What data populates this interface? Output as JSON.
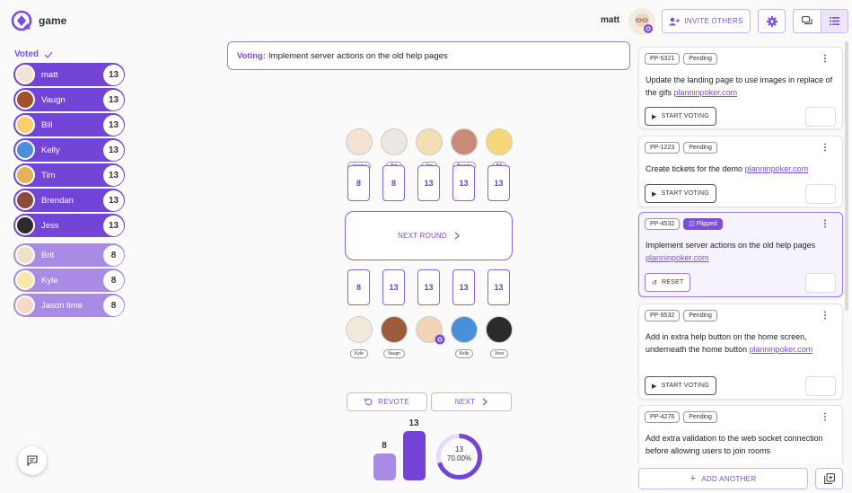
{
  "app": {
    "title": "game"
  },
  "header": {
    "username": "matt",
    "invite_label": "INVITE OTHERS"
  },
  "sidebar": {
    "voted_label": "Voted",
    "voters": [
      {
        "name": "matt",
        "vote": "13",
        "tone": "dark"
      },
      {
        "name": "Vaugn",
        "vote": "13",
        "tone": "dark"
      },
      {
        "name": "Bill",
        "vote": "13",
        "tone": "dark"
      },
      {
        "name": "Kelly",
        "vote": "13",
        "tone": "dark"
      },
      {
        "name": "Tim",
        "vote": "13",
        "tone": "dark"
      },
      {
        "name": "Brendan",
        "vote": "13",
        "tone": "dark"
      },
      {
        "name": "Jess",
        "vote": "13",
        "tone": "dark"
      },
      {
        "name": "Brit",
        "vote": "8",
        "tone": "light"
      },
      {
        "name": "Kyle",
        "vote": "8",
        "tone": "light"
      },
      {
        "name": "Jason time",
        "vote": "8",
        "tone": "light"
      }
    ]
  },
  "voting": {
    "label": "Voting:",
    "ticket": "Implement server actions on the old help pages"
  },
  "table": {
    "top_players": [
      {
        "name": "Jason t",
        "card": "8"
      },
      {
        "name": "Brit",
        "card": "8"
      },
      {
        "name": "Tim",
        "card": "13"
      },
      {
        "name": "Brenda",
        "card": "13"
      },
      {
        "name": "Bill",
        "card": "13"
      }
    ],
    "bottom_players": [
      {
        "name": "Kyle",
        "card": "8"
      },
      {
        "name": "Vaugn",
        "card": "13"
      },
      {
        "name": "",
        "card": "13"
      },
      {
        "name": "Kelly",
        "card": "13"
      },
      {
        "name": "Jess",
        "card": "13"
      }
    ],
    "next_round_label": "NEXT ROUND"
  },
  "controls": {
    "revote_label": "REVOTE",
    "next_label": "NEXT"
  },
  "results": {
    "bars": [
      {
        "label": "8",
        "count": 3
      },
      {
        "label": "13",
        "count": 7
      }
    ],
    "consensus_value": "13",
    "consensus_percent": "70.00%",
    "consensus_fraction": 0.7
  },
  "tickets": [
    {
      "id": "PP-5321",
      "status": "Pending",
      "text": "Update the landing page to use images in replace of the gifs",
      "link": "planninpoker.com",
      "action": "START VOTING"
    },
    {
      "id": "PP-1223",
      "status": "Pending",
      "text": "Create tickets for the demo",
      "link": "planninpoker.com",
      "action": "START VOTING"
    },
    {
      "id": "PP-4532",
      "status": "Flipped",
      "text": "Implement server actions on the old help pages",
      "link": "planninpoker.com",
      "action": "RESET"
    },
    {
      "id": "PP-9532",
      "status": "Pending",
      "text": "Add in extra help button on the home screen, underneath the home button",
      "link": "planninpoker.com",
      "action": "START VOTING"
    },
    {
      "id": "PP-4276",
      "status": "Pending",
      "text": "Add extra validation to the web socket connection before allowing users to join rooms",
      "link": "",
      "action": ""
    }
  ],
  "add_another_label": "ADD ANOTHER",
  "colors": {
    "accent": "#7c4dde",
    "dark_vote": "#7245d6",
    "light_vote": "#a98ae4"
  }
}
